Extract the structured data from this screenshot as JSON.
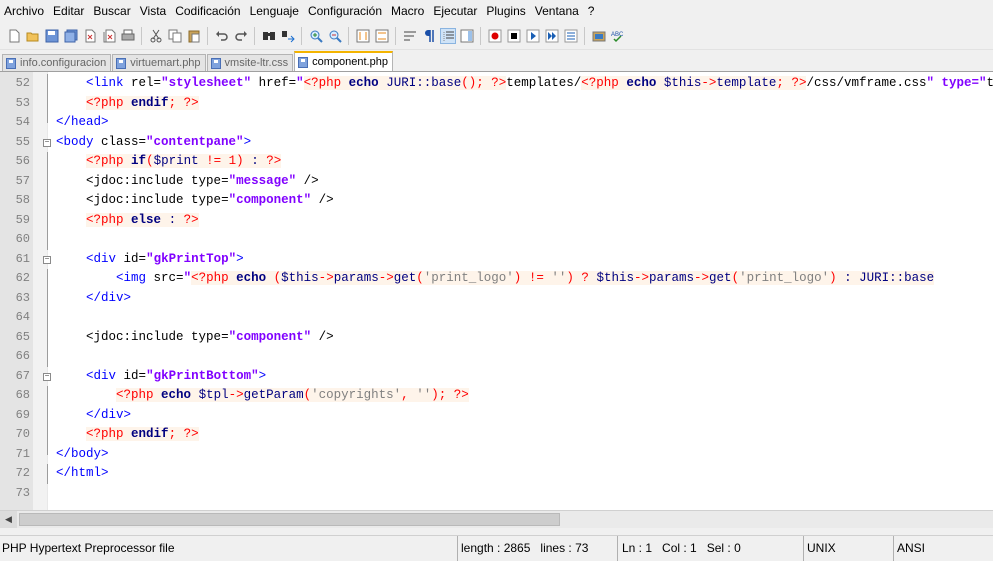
{
  "menu": [
    "Archivo",
    "Editar",
    "Buscar",
    "Vista",
    "Codificación",
    "Lenguaje",
    "Configuración",
    "Macro",
    "Ejecutar",
    "Plugins",
    "Ventana",
    "?"
  ],
  "toolbar_icons": [
    "new-file-icon",
    "open-file-icon",
    "save-icon",
    "save-all-icon",
    "close-icon",
    "close-all-icon",
    "print-icon",
    "cut-icon",
    "copy-icon",
    "paste-icon",
    "undo-icon",
    "redo-icon",
    "find-icon",
    "replace-icon",
    "zoom-in-icon",
    "zoom-out-icon",
    "sync-vertical-icon",
    "sync-horizontal-icon",
    "word-wrap-icon",
    "show-all-chars-icon",
    "indent-guide-icon",
    "doc-map-icon",
    "record-macro-icon",
    "stop-record-icon",
    "play-macro-icon",
    "run-macro-multiple-icon",
    "save-macro-icon",
    "run-icon",
    "spellcheck-icon"
  ],
  "tabs": [
    {
      "label": "info.configuracion",
      "active": false
    },
    {
      "label": "virtuemart.php",
      "active": false
    },
    {
      "label": "vmsite-ltr.css",
      "active": false
    },
    {
      "label": "component.php",
      "active": true
    }
  ],
  "lines": [
    {
      "num": "52",
      "code": "    <link rel=\"stylesheet\" href=\"<?php echo JURI::base(); ?>templates/<?php echo $this->template; ?>/css/vmframe.css\" type=\"text/css\" />"
    },
    {
      "num": "53",
      "code": "    <?php endif; ?>"
    },
    {
      "num": "54",
      "code": "</head>"
    },
    {
      "num": "55",
      "code": "<body class=\"contentpane\">"
    },
    {
      "num": "56",
      "code": "    <?php if($print != 1) : ?>"
    },
    {
      "num": "57",
      "code": "    <jdoc:include type=\"message\" />"
    },
    {
      "num": "58",
      "code": "    <jdoc:include type=\"component\" />"
    },
    {
      "num": "59",
      "code": "    <?php else : ?>"
    },
    {
      "num": "60",
      "code": ""
    },
    {
      "num": "61",
      "code": "    <div id=\"gkPrintTop\">"
    },
    {
      "num": "62",
      "code": "        <img src=\"<?php echo ($this->params->get('print_logo') != '') ? $this->params->get('print_logo') : JURI::base"
    },
    {
      "num": "63",
      "code": "    </div>"
    },
    {
      "num": "64",
      "code": ""
    },
    {
      "num": "65",
      "code": "    <jdoc:include type=\"component\" />"
    },
    {
      "num": "66",
      "code": ""
    },
    {
      "num": "67",
      "code": "    <div id=\"gkPrintBottom\">"
    },
    {
      "num": "68",
      "code": "        <?php echo $tpl->getParam('copyrights', ''); ?>"
    },
    {
      "num": "69",
      "code": "    </div>"
    },
    {
      "num": "70",
      "code": "    <?php endif; ?>"
    },
    {
      "num": "71",
      "code": "</body>"
    },
    {
      "num": "72",
      "code": "</html>"
    },
    {
      "num": "73",
      "code": ""
    }
  ],
  "status": {
    "file_type": "PHP Hypertext Preprocessor file",
    "length": "length : 2865",
    "lines": "lines : 73",
    "ln": "Ln : 1",
    "col": "Col : 1",
    "sel": "Sel : 0",
    "eol": "UNIX",
    "encoding": "ANSI"
  }
}
